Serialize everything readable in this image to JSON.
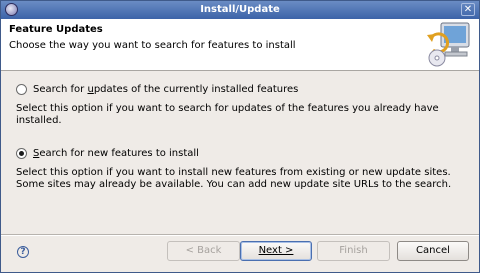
{
  "window": {
    "title": "Install/Update",
    "close_glyph": "✕"
  },
  "banner": {
    "heading": "Feature Updates",
    "subtitle": "Choose the way you want to search for features to install",
    "icon": "computer-update-icon"
  },
  "options": [
    {
      "label_prefix": "Search for ",
      "label_mnemonic": "u",
      "label_suffix": "pdates of the currently installed features",
      "checked": false,
      "description_line1": "Select this option if you want to search for updates of the features you already have",
      "description_line2": "installed."
    },
    {
      "label_prefix": "",
      "label_mnemonic": "S",
      "label_suffix": "earch for new features to install",
      "checked": true,
      "description_line1": "Select this option if you want to install new features from existing or new update sites.",
      "description_line2": "Some sites may already be available. You can add new update site URLs to the search."
    }
  ],
  "footer": {
    "help_glyph": "?",
    "back_label": "< Back",
    "next_label": "Next >",
    "finish_label": "Finish",
    "cancel_label": "Cancel"
  }
}
